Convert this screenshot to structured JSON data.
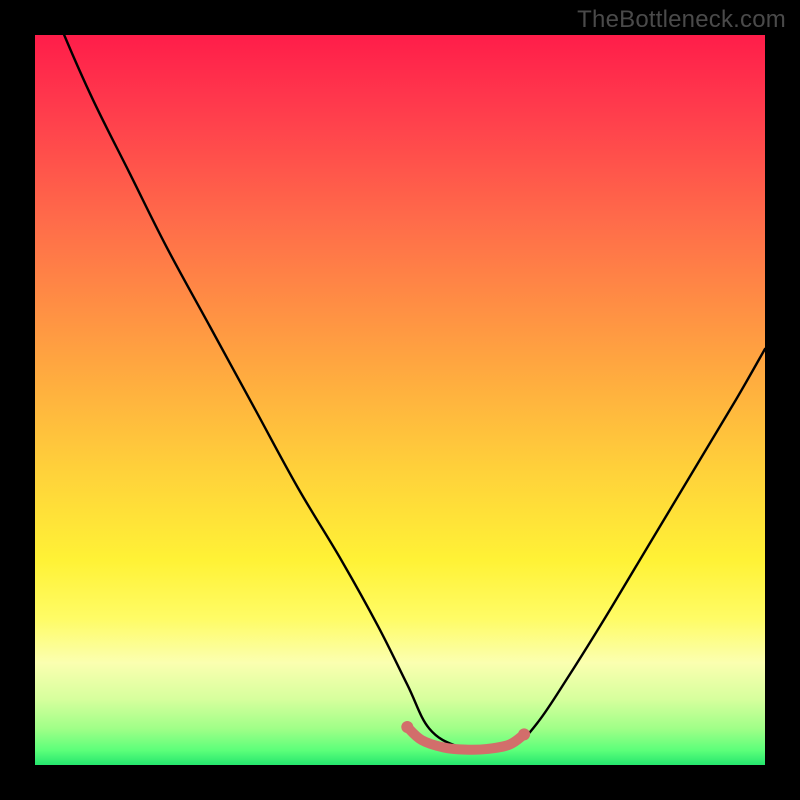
{
  "watermark": "TheBottleneck.com",
  "chart_data": {
    "type": "line",
    "title": "",
    "xlabel": "",
    "ylabel": "",
    "xlim": [
      0,
      100
    ],
    "ylim": [
      0,
      100
    ],
    "grid": false,
    "legend": false,
    "description": "V-shaped bottleneck curve against vertical gradient (red high → green low). Lower values indicate better balance. Trough flattens near x≈54–66 at y≈2. A short salmon highlight segment marks the flat bottom region.",
    "series": [
      {
        "name": "bottleneck-curve",
        "color": "#000000",
        "x": [
          0,
          4,
          8,
          13,
          18,
          24,
          30,
          36,
          42,
          47,
          51,
          54,
          58,
          62,
          66,
          69,
          73,
          78,
          84,
          90,
          96,
          100
        ],
        "y": [
          110,
          100,
          91,
          81,
          71,
          60,
          49,
          38,
          28,
          19,
          11,
          5,
          2.5,
          2,
          3,
          6,
          12,
          20,
          30,
          40,
          50,
          57
        ]
      },
      {
        "name": "optimal-range-highlight",
        "color": "#d26e6b",
        "x": [
          51,
          53,
          56,
          59,
          62,
          65,
          67
        ],
        "y": [
          5.2,
          3.4,
          2.4,
          2.1,
          2.2,
          2.8,
          4.2
        ]
      }
    ]
  }
}
